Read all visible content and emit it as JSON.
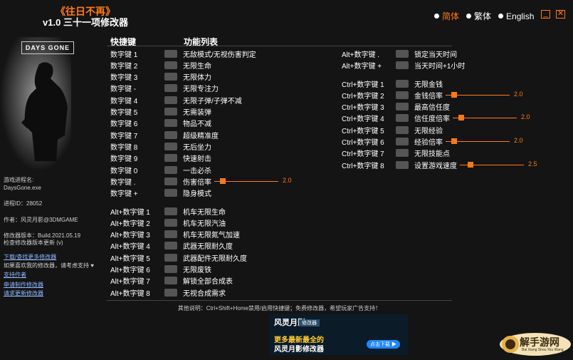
{
  "title": {
    "game": "《往日不再》",
    "version": "v1.0 三十一项修改器"
  },
  "languages": [
    {
      "label": "简体",
      "active": true
    },
    {
      "label": "繁体",
      "active": false
    },
    {
      "label": "English",
      "active": false
    }
  ],
  "window": {
    "minimize": "_",
    "close": "✕"
  },
  "logo": "DAYS GONE",
  "sidebar": {
    "process_label": "游戏进程名:",
    "process_value": "DaysGone.exe",
    "pid": "进程ID：28052",
    "author": "作者：风灵月影@3DMGAME",
    "version_line": "修改器版本：Build.2021.05.19",
    "check_update": "检查修改器版本更新 (v)",
    "download_more": "下载/查找更多修改器",
    "support_text": "如果喜欢我的修改器，请考虑支持 ♥",
    "support_me": "支持作者",
    "request": "申请制作修改器",
    "request_update": "请求更新修改器"
  },
  "headers": {
    "hotkey": "快捷键",
    "features": "功能列表"
  },
  "left_items": [
    {
      "key": "数字键 1",
      "label": "无敌模式/无视伤害判定"
    },
    {
      "key": "数字键 2",
      "label": "无限生命"
    },
    {
      "key": "数字键 3",
      "label": "无限体力"
    },
    {
      "key": "数字键 -",
      "label": "无限专注力"
    },
    {
      "key": "数字键 4",
      "label": "无限子弹/子弹不减"
    },
    {
      "key": "数字键 5",
      "label": "无需装弹"
    },
    {
      "key": "数字键 6",
      "label": "物品不减"
    },
    {
      "key": "数字键 7",
      "label": "超级精准度"
    },
    {
      "key": "数字键 8",
      "label": "无后坐力"
    },
    {
      "key": "数字键 9",
      "label": "快速射击"
    },
    {
      "key": "数字键 0",
      "label": "一击必杀"
    },
    {
      "key": "数字键 .",
      "label": "伤害倍率",
      "slider_value": "2.0",
      "slider_fraction": 0.18
    },
    {
      "key": "数字键 +",
      "label": "隐身模式"
    }
  ],
  "alt_items": [
    {
      "key": "Alt+数字键 1",
      "label": "机车无限生命"
    },
    {
      "key": "Alt+数字键 2",
      "label": "机车无限汽油"
    },
    {
      "key": "Alt+数字键 3",
      "label": "机车无限氮气加速"
    },
    {
      "key": "Alt+数字键 4",
      "label": "武器无限耐久度"
    },
    {
      "key": "Alt+数字键 5",
      "label": "武器配件无限耐久度"
    },
    {
      "key": "Alt+数字键 6",
      "label": "无限废铁"
    },
    {
      "key": "Alt+数字键 7",
      "label": "解锁全部合成表"
    },
    {
      "key": "Alt+数字键 8",
      "label": "无视合成需求"
    }
  ],
  "right_items": [
    {
      "key": "Alt+数字键 .",
      "label": "锁定当天时间"
    },
    {
      "key": "Alt+数字键 +",
      "label": "当天时间+1小时"
    }
  ],
  "ctrl_items": [
    {
      "key": "Ctrl+数字键 1",
      "label": "无限金钱"
    },
    {
      "key": "Ctrl+数字键 2",
      "label": "金钱倍率",
      "slider_value": "2.0",
      "slider_fraction": 0.18
    },
    {
      "key": "Ctrl+数字键 3",
      "label": "最高信任度"
    },
    {
      "key": "Ctrl+数字键 4",
      "label": "信任度倍率",
      "slider_value": "2.0",
      "slider_fraction": 0.18
    },
    {
      "key": "Ctrl+数字键 5",
      "label": "无限经验"
    },
    {
      "key": "Ctrl+数字键 6",
      "label": "经验倍率",
      "slider_value": "2.0",
      "slider_fraction": 0.18
    },
    {
      "key": "Ctrl+数字键 7",
      "label": "无限技能点"
    },
    {
      "key": "Ctrl+数字键 8",
      "label": "设置游戏速度",
      "slider_value": "2.5",
      "slider_fraction": 0.25
    }
  ],
  "footer": "其他说明：Ctrl+Shift+Home禁用/启用快捷键；免费修改器，希望玩家广告支持！",
  "ad": {
    "brand": "风灵月影",
    "tag": "修改器",
    "line1": "更多最新最全的",
    "line2": "风灵月影修改器",
    "button": "点击下载 ▶"
  },
  "watermark": {
    "text": "解手游网",
    "sub": "Bai Xiang Shou You Wang"
  },
  "colors": {
    "accent": "#ff7a18",
    "background": "#141414"
  }
}
